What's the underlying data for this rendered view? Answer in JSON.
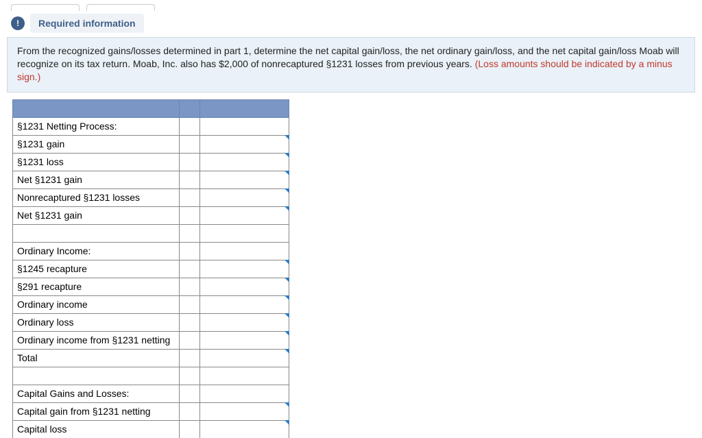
{
  "header": {
    "info_label": "Required information",
    "badge_glyph": "!"
  },
  "instructions": {
    "main": "From the recognized gains/losses determined in part 1, determine the net capital gain/loss, the net ordinary gain/loss, and the net capital gain/loss Moab will recognize on its tax return. Moab, Inc. also has $2,000 of nonrecaptured §1231 losses from previous years. ",
    "note_red": "(Loss amounts should be indicated by a minus sign.)"
  },
  "rows": [
    {
      "type": "header"
    },
    {
      "type": "label",
      "text": "§1231 Netting Process:"
    },
    {
      "type": "entry",
      "text": "§1231 gain"
    },
    {
      "type": "entry",
      "text": "§1231 loss"
    },
    {
      "type": "entry",
      "text": "Net §1231 gain"
    },
    {
      "type": "entry",
      "text": "Nonrecaptured §1231 losses"
    },
    {
      "type": "entry",
      "text": "Net §1231 gain"
    },
    {
      "type": "gap"
    },
    {
      "type": "label",
      "text": "Ordinary Income:"
    },
    {
      "type": "entry",
      "text": "§1245 recapture"
    },
    {
      "type": "entry",
      "text": "§291 recapture"
    },
    {
      "type": "entry",
      "text": "Ordinary income"
    },
    {
      "type": "entry",
      "text": "Ordinary loss"
    },
    {
      "type": "entry",
      "text": "Ordinary income from §1231 netting"
    },
    {
      "type": "entry",
      "text": "Total"
    },
    {
      "type": "gap"
    },
    {
      "type": "label",
      "text": "Capital Gains and Losses:"
    },
    {
      "type": "entry",
      "text": "Capital gain from §1231 netting"
    },
    {
      "type": "entry-cut",
      "text": "Capital loss"
    }
  ]
}
